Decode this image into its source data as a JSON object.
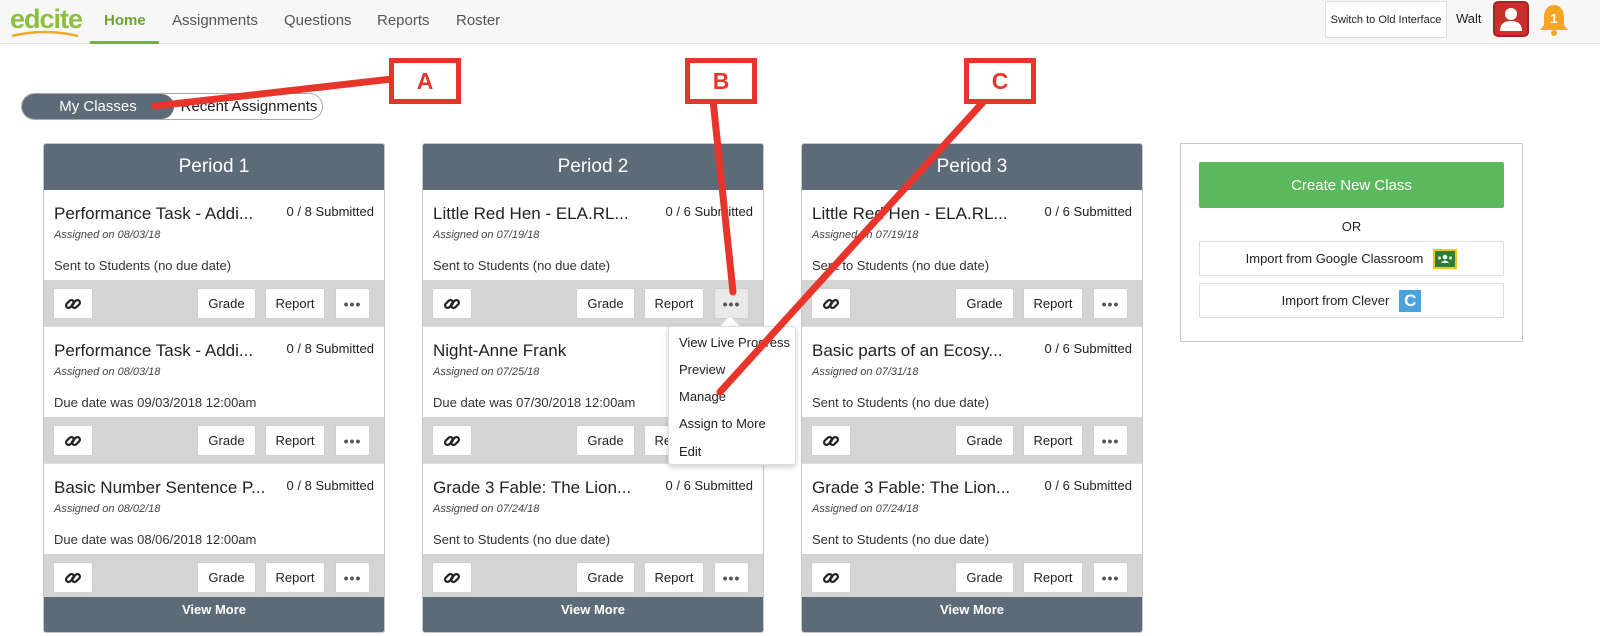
{
  "app": {
    "logo_text": "edcite",
    "accent": "#7bb03a"
  },
  "nav": {
    "items": [
      "Home",
      "Assignments",
      "Questions",
      "Reports",
      "Roster"
    ],
    "active": "Home"
  },
  "header": {
    "switch_button": "Switch to Old Interface",
    "user_name": "Walt",
    "notification_count": "1"
  },
  "toggle": {
    "my_classes": "My Classes",
    "recent_assignments": "Recent Assignments"
  },
  "buttons": {
    "grade": "Grade",
    "report": "Report",
    "more": "•••",
    "view_more": "View More"
  },
  "classes": [
    {
      "name": "Period 1",
      "assignments": [
        {
          "title": "Performance Task - Addi...",
          "submitted": "0 / 8 Submitted",
          "assigned": "Assigned on 08/03/18",
          "status": "Sent to Students (no due date)"
        },
        {
          "title": "Performance Task - Addi...",
          "submitted": "0 / 8 Submitted",
          "assigned": "Assigned on 08/03/18",
          "status": "Due date was 09/03/2018 12:00am"
        },
        {
          "title": "Basic Number Sentence P...",
          "submitted": "0 / 8 Submitted",
          "assigned": "Assigned on 08/02/18",
          "status": "Due date was 08/06/2018 12:00am"
        }
      ]
    },
    {
      "name": "Period 2",
      "assignments": [
        {
          "title": "Little Red Hen - ELA.RL...",
          "submitted": "0 / 6 Submitted",
          "assigned": "Assigned on 07/19/18",
          "status": "Sent to Students (no due date)"
        },
        {
          "title": "Night-Anne Frank",
          "submitted": "",
          "assigned": "Assigned on 07/25/18",
          "status": "Due date was 07/30/2018 12:00am"
        },
        {
          "title": "Grade 3 Fable: The Lion...",
          "submitted": "0 / 6 Submitted",
          "assigned": "Assigned on 07/24/18",
          "status": "Sent to Students (no due date)"
        }
      ]
    },
    {
      "name": "Period 3",
      "assignments": [
        {
          "title": "Little Red Hen - ELA.RL...",
          "submitted": "0 / 6 Submitted",
          "assigned": "Assigned on 07/19/18",
          "status": "Sent to Students (no due date)"
        },
        {
          "title": "Basic parts of an Ecosy...",
          "submitted": "0 / 6 Submitted",
          "assigned": "Assigned on 07/31/18",
          "status": "Sent to Students (no due date)"
        },
        {
          "title": "Grade 3 Fable: The Lion...",
          "submitted": "0 / 6 Submitted",
          "assigned": "Assigned on 07/24/18",
          "status": "Sent to Students (no due date)"
        }
      ]
    }
  ],
  "side_panel": {
    "create_label": "Create New Class",
    "or_label": "OR",
    "google_label": "Import from Google Classroom",
    "clever_label": "Import from Clever",
    "clever_icon_letter": "C"
  },
  "menu": {
    "items": [
      "View Live Progress",
      "Preview",
      "Manage",
      "Assign to More",
      "Edit"
    ]
  },
  "callouts": {
    "a": "A",
    "b": "B",
    "c": "C",
    "color": "#e8352b"
  }
}
